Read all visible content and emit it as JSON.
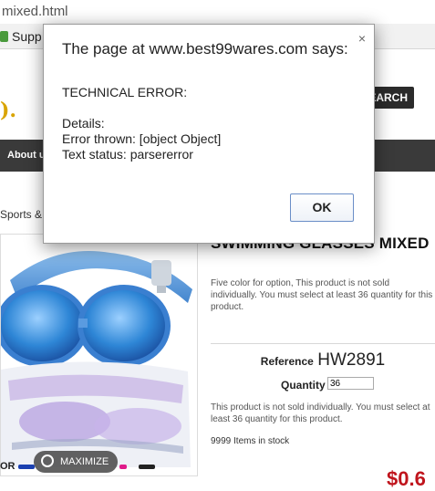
{
  "browser": {
    "url_fragment": "mixed.html",
    "bookmark_fragment": "Supp"
  },
  "site": {
    "search_button": "EARCH",
    "nav_about": "About us",
    "breadcrumb": "Sports & "
  },
  "product": {
    "title": "SWIMMING GLASSES MIXED",
    "description": "Five color for option, This product is not sold individually. You must select at least 36 quantity for this product.",
    "reference_label": "Reference",
    "reference_value": "HW2891",
    "quantity_label": "Quantity",
    "quantity_value": "36",
    "note": "This product is not sold individually. You must select at least 36 quantity for this product.",
    "stock": "9999 Items in stock",
    "price_fragment": "$0.6",
    "maximize_label": "MAXIMIZE",
    "color_label_fragment": "OR",
    "swatch_colors": [
      "#1a3fb0",
      "#e01a8a",
      "#2aa0d8",
      "#7b2fbf",
      "#222222"
    ]
  },
  "dialog": {
    "title": "The page at www.best99wares.com says:",
    "close_glyph": "×",
    "lines": [
      "TECHNICAL ERROR:",
      "",
      "Details:",
      "Error thrown: [object Object]",
      "Text status: parsererror"
    ],
    "ok_label": "OK"
  }
}
